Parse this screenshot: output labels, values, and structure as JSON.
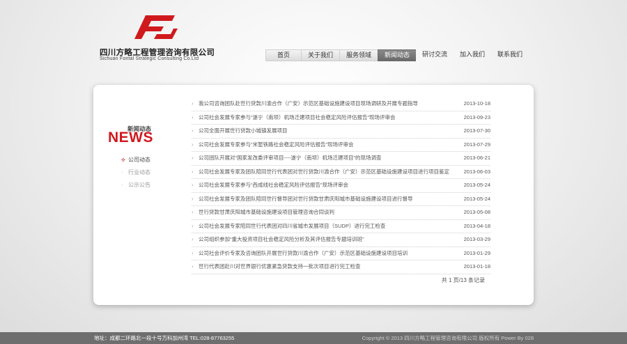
{
  "header": {
    "company_cn": "四川方略工程管理咨询有限公司",
    "company_en": "Sichuan Fontal Strategic Consulting Co.Ltd"
  },
  "nav": [
    "首页",
    "关于我们",
    "服务领域",
    "新闻动态",
    "研讨交流",
    "加入我们",
    "联系我们"
  ],
  "nav_active": "新闻动态",
  "sidebar": {
    "title_cn": "新闻动态",
    "title_en": "NEWS",
    "items": [
      "公司动态",
      "行业动态",
      "公示公告"
    ]
  },
  "news": [
    {
      "title": "我公司咨询团队赴世行贷款川渝合作（广安）示范区基础设施建设项目现场调研及开展专题指导",
      "date": "2013-10-18"
    },
    {
      "title": "公司社会发展专家参与“遂宁（南坝）机场迁建项目社会稳定风险评估报告”现场评审会",
      "date": "2013-09-23"
    },
    {
      "title": "公司全面开展世行贷款小城镇发展项目",
      "date": "2013-07-30"
    },
    {
      "title": "公司社会发展专家参与“米堑铁路社会稳定风险评估报告”现场评审会",
      "date": "2013-07-29"
    },
    {
      "title": "公司团队开展对“国家发改委评审项目----遂宁（南坝）机场迁建项目”的现场调查",
      "date": "2013-06-21"
    },
    {
      "title": "公司社会发展专家及团队陪同世行代表团对世行贷款川渝合作（广安）示范区基础设施建设项目进行项目鉴定",
      "date": "2013-06-03"
    },
    {
      "title": "公司社会发展专家参与“西成线社会稳定风险评估报告”现场评审会",
      "date": "2013-05-24"
    },
    {
      "title": "公司社会发展专家及团队陪同世行督导团对世行贷款甘肃庆阳城市基础设施建设项目进行督导",
      "date": "2013-05-24"
    },
    {
      "title": "世行贷款甘肃庆阳城市基础设施建设项目管理咨询合同谈判",
      "date": "2013-05-08"
    },
    {
      "title": "公司社会发展专家陪同世行代表团对四川省城市发展项目（SUDP）进行完工检查",
      "date": "2013-04-18"
    },
    {
      "title": "公司组织参加“重大投资项目社会稳定风险分析及其评估报告专题培训班”",
      "date": "2013-03-29"
    },
    {
      "title": "公司社会评价专家及咨询团队开展世行贷款川渝合作（广安）示范区基础设施建设项目培训",
      "date": "2013-01-29"
    },
    {
      "title": "世行代表团赴川对世界银行优惠紧急贷款支持一批次项目进行完工检查",
      "date": "2013-01-18"
    }
  ],
  "pager": "共 1 页/13 条记录",
  "footer": {
    "address": "地址：成都二环路北一段十号万科加州湾 TEL:028-87763255",
    "copyright": "Copyright © 2013 四川方略工程管理咨询有限公司 版权所有 Power By 028"
  },
  "colors": {
    "brand_red": "#d0191d",
    "nav_active_bg": "#777777",
    "footer_bg": "#6e6e6e"
  }
}
